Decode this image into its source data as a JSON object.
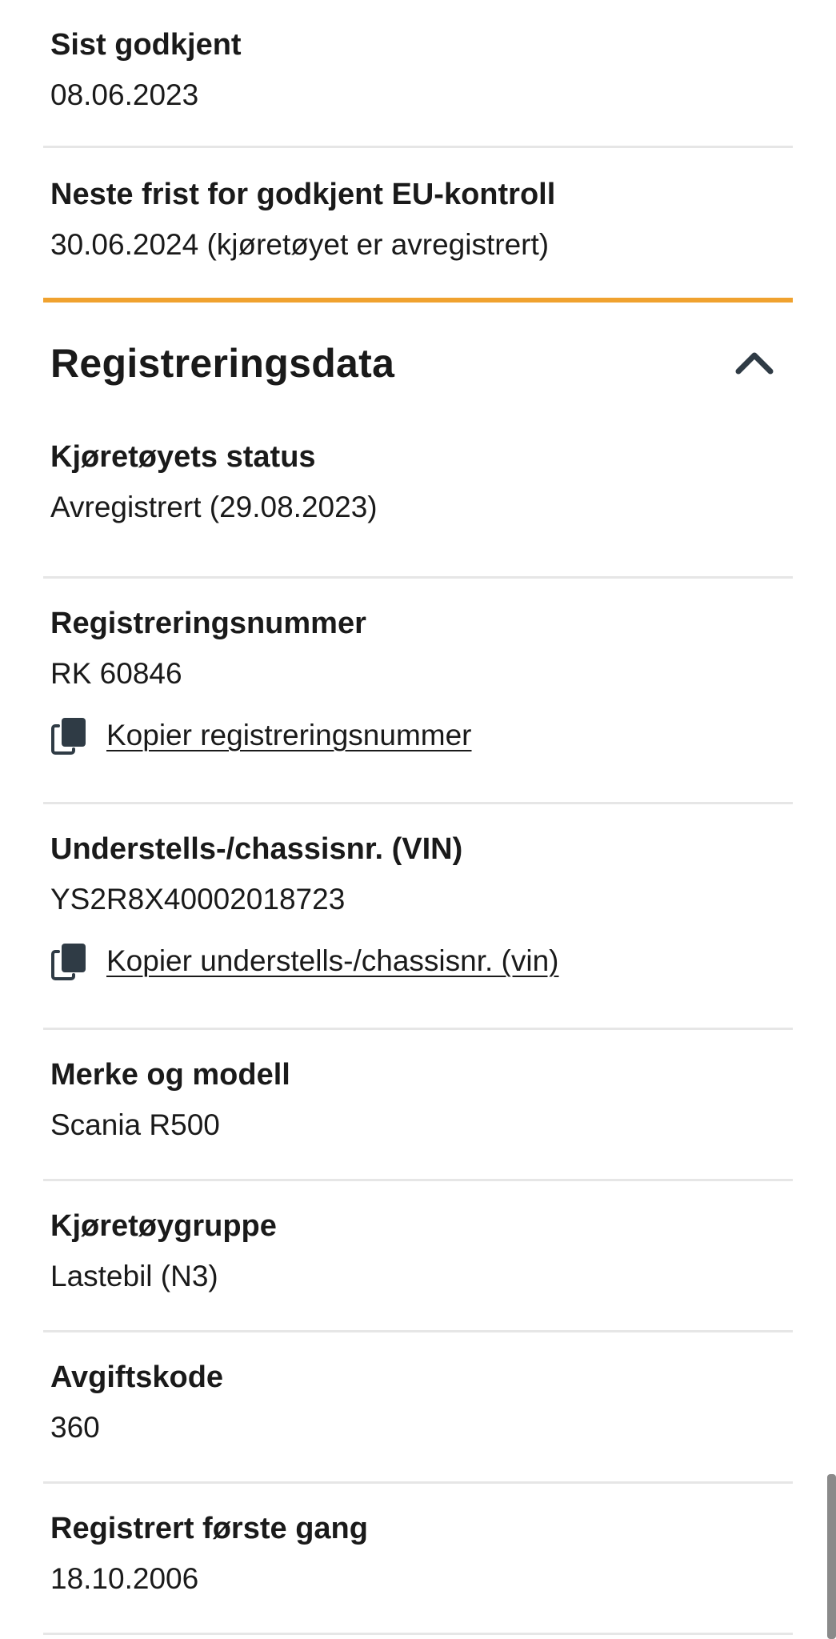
{
  "top_fields": [
    {
      "label": "Sist godkjent",
      "value": "08.06.2023"
    },
    {
      "label": "Neste frist for godkjent EU-kontroll",
      "value": "30.06.2024 (kjøretøyet er avregistrert)"
    }
  ],
  "accent_color": "#f0a22f",
  "section": {
    "title": "Registreringsdata",
    "toggle_icon": "chevron-up-icon"
  },
  "registration_fields": [
    {
      "label": "Kjøretøyets status",
      "value": "Avregistrert (29.08.2023)"
    },
    {
      "label": "Registreringsnummer",
      "value": "RK 60846",
      "copy_label": "Kopier registreringsnummer"
    },
    {
      "label": "Understells-/chassisnr. (VIN)",
      "value": "YS2R8X40002018723",
      "copy_label": "Kopier understells-/chassisnr. (vin)"
    },
    {
      "label": "Merke og modell",
      "value": "Scania R500"
    },
    {
      "label": "Kjøretøygruppe",
      "value": "Lastebil (N3)"
    },
    {
      "label": "Avgiftskode",
      "value": "360"
    },
    {
      "label": "Registrert første gang",
      "value": "18.10.2006"
    }
  ]
}
